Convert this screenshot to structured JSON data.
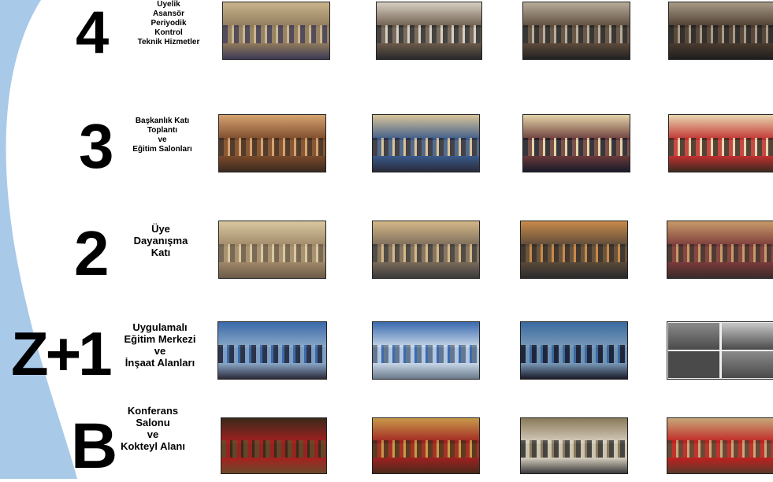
{
  "accent_color": "#a9c9e9",
  "floors": [
    {
      "number": "4",
      "label_lines": [
        "Üyelik",
        "Asansör",
        "Periyodik",
        "Kontrol",
        "Teknik Hizmetler"
      ],
      "photos": [
        {
          "desc": "meeting-room-photo",
          "tones": [
            "#c9b48c",
            "#8f7a5c",
            "#3e3a55"
          ]
        },
        {
          "desc": "conference-room-photo",
          "tones": [
            "#d8cfc4",
            "#6a5a4a",
            "#2a2a2a"
          ]
        },
        {
          "desc": "conference-room-photo",
          "tones": [
            "#b8ac9a",
            "#5c4a3a",
            "#222222"
          ]
        },
        {
          "desc": "conference-room-photo",
          "tones": [
            "#a89a86",
            "#4a3a2e",
            "#1e1e1e"
          ]
        }
      ]
    },
    {
      "number": "3",
      "label_lines": [
        "Başkanlık Katı",
        "Toplantı",
        "ve",
        "Eğitim Salonları"
      ],
      "photos": [
        {
          "desc": "meeting-hall-photo",
          "tones": [
            "#d6a270",
            "#7a4a2a",
            "#3a2a20"
          ]
        },
        {
          "desc": "training-hall-photo",
          "tones": [
            "#d8c49a",
            "#3a5a8a",
            "#2a2a3a"
          ]
        },
        {
          "desc": "training-hall-photo",
          "tones": [
            "#e4d4a8",
            "#6a3a3a",
            "#1a1a2a"
          ]
        },
        {
          "desc": "training-hall-photo",
          "tones": [
            "#e8d6b0",
            "#c03030",
            "#3a2a20"
          ]
        }
      ]
    },
    {
      "number": "2",
      "label_lines": [
        "Üye",
        "Dayanışma",
        "Katı"
      ],
      "photos": [
        {
          "desc": "lounge-photo",
          "tones": [
            "#d8c8a0",
            "#a08868",
            "#6a5a48"
          ]
        },
        {
          "desc": "lounge-photo",
          "tones": [
            "#d4b888",
            "#7a6a5a",
            "#3a3a3a"
          ]
        },
        {
          "desc": "dining-hall-photo",
          "tones": [
            "#c88a4a",
            "#5a4a3a",
            "#2a2a2a"
          ]
        },
        {
          "desc": "event-photo",
          "tones": [
            "#c89a6a",
            "#7a3a3a",
            "#3a2a2a"
          ]
        }
      ]
    },
    {
      "number": "Z+1",
      "label_lines": [
        "Uygulamalı",
        "Eğitim Merkezi",
        "ve",
        "İnşaat Alanları"
      ],
      "photos": [
        {
          "desc": "training-center-photo",
          "tones": [
            "#3a6aa8",
            "#8aa8c8",
            "#2a2a3a"
          ]
        },
        {
          "desc": "training-center-photo",
          "tones": [
            "#3a6ab0",
            "#c8d8e8",
            "#6a7a8a"
          ]
        },
        {
          "desc": "training-center-photo",
          "tones": [
            "#3a6aa0",
            "#7a9ab8",
            "#1a1a2a"
          ]
        },
        {
          "desc": "construction-area-photo",
          "tones": [
            "#8a8a8a",
            "#c8c8c8",
            "#4a4a4a"
          ]
        }
      ]
    },
    {
      "number": "B",
      "label_lines": [
        "Konferans",
        "Salonu",
        "ve",
        "Kokteyl Alanı"
      ],
      "photos": [
        {
          "desc": "conference-hall-photo",
          "tones": [
            "#3a2a1a",
            "#a82020",
            "#6a4a2a"
          ]
        },
        {
          "desc": "conference-hall-photo",
          "tones": [
            "#c89a4a",
            "#a02020",
            "#4a2a1a"
          ]
        },
        {
          "desc": "cocktail-area-photo",
          "tones": [
            "#8a7a5a",
            "#d8d0c0",
            "#3a3a3a"
          ]
        },
        {
          "desc": "conference-hall-photo",
          "tones": [
            "#c8a87a",
            "#c02020",
            "#5a3a2a"
          ]
        }
      ]
    }
  ]
}
